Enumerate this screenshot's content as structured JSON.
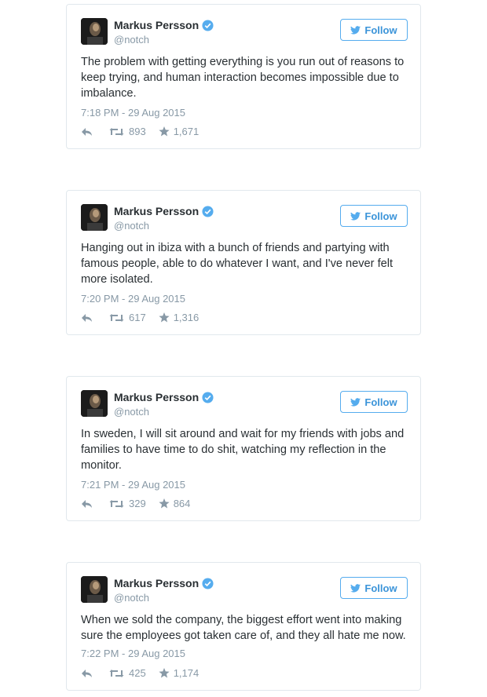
{
  "follow_label": "Follow",
  "tweets": [
    {
      "name": "Markus Persson",
      "handle": "@notch",
      "text": "The problem with getting everything is you run out of reasons to keep trying, and human interaction becomes impossible due to imbalance.",
      "time": "7:18 PM - 29 Aug 2015",
      "retweets": "893",
      "likes": "1,671"
    },
    {
      "name": "Markus Persson",
      "handle": "@notch",
      "text": "Hanging out in ibiza with a bunch of friends and partying with famous people, able to do whatever I want, and I've never felt more isolated.",
      "time": "7:20 PM - 29 Aug 2015",
      "retweets": "617",
      "likes": "1,316"
    },
    {
      "name": "Markus Persson",
      "handle": "@notch",
      "text": "In sweden, I will sit around and wait for my friends with jobs and families to have time to do shit, watching my reflection in the monitor.",
      "time": "7:21 PM - 29 Aug 2015",
      "retweets": "329",
      "likes": "864"
    },
    {
      "name": "Markus Persson",
      "handle": "@notch",
      "text": "When we sold the company, the biggest effort went into making sure the employees got taken care of, and they all hate me now.",
      "time": "7:22 PM - 29 Aug 2015",
      "retweets": "425",
      "likes": "1,174"
    }
  ],
  "colors": {
    "accent": "#55acee",
    "text": "#292f33",
    "muted": "#8899a6",
    "border": "#e1e8ed"
  },
  "icons": {
    "verified": "verified-badge-icon",
    "bird": "twitter-bird-icon",
    "reply": "reply-icon",
    "retweet": "retweet-icon",
    "like": "star-icon"
  }
}
